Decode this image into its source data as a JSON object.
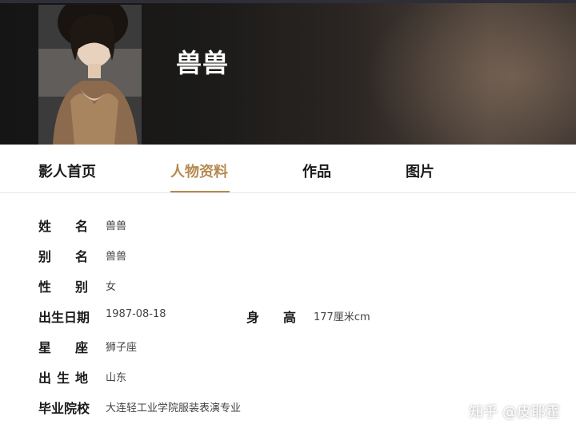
{
  "profile": {
    "name": "兽兽"
  },
  "tabs": [
    {
      "label": "影人首页"
    },
    {
      "label": "人物资料"
    },
    {
      "label": "作品"
    },
    {
      "label": "图片"
    }
  ],
  "info": {
    "name_label": [
      "姓",
      "名"
    ],
    "name_value": "兽兽",
    "alias_label": [
      "别",
      "名"
    ],
    "alias_value": "兽兽",
    "gender_label": [
      "性",
      "别"
    ],
    "gender_value": "女",
    "birth_label": "出生日期",
    "birth_value": "1987-08-18",
    "height_label": [
      "身",
      "高"
    ],
    "height_value": "177厘米cm",
    "zodiac_label": [
      "星",
      "座"
    ],
    "zodiac_value": "狮子座",
    "birthplace_label": [
      "出",
      "生",
      "地"
    ],
    "birthplace_value": "山东",
    "school_label": "毕业院校",
    "school_value": "大连轻工业学院服装表演专业"
  },
  "watermark": "知乎 @皮耶霍",
  "colors": {
    "accent": "#b58a4f"
  }
}
